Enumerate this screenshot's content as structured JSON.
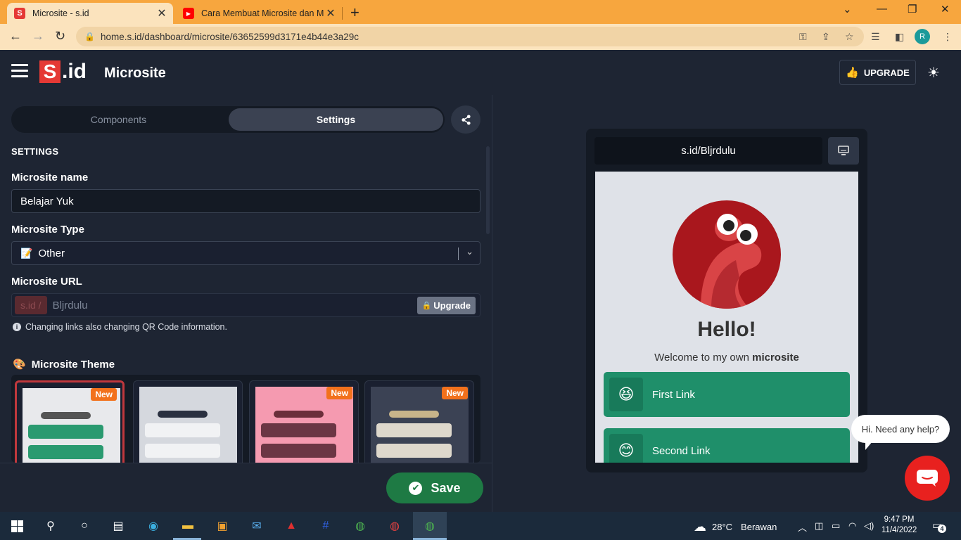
{
  "browser": {
    "tabs": [
      {
        "title": "Microsite - s.id",
        "favicon": "sid-favicon",
        "active": true
      },
      {
        "title": "Cara Membuat Microsite dan Me",
        "favicon": "youtube-favicon",
        "active": false
      }
    ],
    "url": "home.s.id/dashboard/microsite/63652599d3171e4b44e3a29c",
    "profile_initial": "R",
    "colors": {
      "tabbar": "#f7a63e",
      "toolbar": "#fbe3bd"
    }
  },
  "header": {
    "logo_s": "S",
    "logo_id": ".id",
    "title": "Microsite",
    "upgrade_label": "UPGRADE"
  },
  "tabs": {
    "components_label": "Components",
    "settings_label": "Settings"
  },
  "settings": {
    "heading": "SETTINGS",
    "name_label": "Microsite name",
    "name_value": "Belajar Yuk",
    "type_label": "Microsite Type",
    "type_emoji": "📝",
    "type_value": "Other",
    "url_label": "Microsite URL",
    "url_prefix": "s.id  /",
    "url_value": "Bljrdulu",
    "url_upgrade": "Upgrade",
    "info_note": "Changing links also changing QR Code information.",
    "theme_emoji": "🎨",
    "theme_label": "Microsite Theme",
    "new_badge": "New",
    "themes": [
      {
        "bg": "#e8e9ec",
        "accent": "#555555",
        "btn": "#2a9a70",
        "new": true,
        "selected": true
      },
      {
        "bg": "#d5d8de",
        "accent": "#2a3040",
        "btn": "#f1f2f4",
        "new": false,
        "selected": false
      },
      {
        "bg": "#f59ab0",
        "accent": "#6b2e3a",
        "btn": "#6b3644",
        "new": true,
        "selected": false
      },
      {
        "bg": "#3b4254",
        "accent": "#c8b48a",
        "btn": "#ded8cc",
        "new": true,
        "selected": false
      }
    ],
    "save_label": "Save"
  },
  "preview": {
    "url": "s.id/Bljrdulu",
    "hello": "Hello!",
    "welcome_text": "Welcome to my own",
    "welcome_bold": "microsite",
    "links": [
      {
        "emoji": "😆",
        "label": "First Link"
      },
      {
        "emoji": "😊",
        "label": "Second Link"
      }
    ]
  },
  "chat": {
    "bubble": "Hi. Need any help?"
  },
  "taskbar": {
    "weather_temp": "28°C",
    "weather_desc": "Berawan",
    "time": "9:47 PM",
    "date": "11/4/2022",
    "notifications": "4"
  }
}
